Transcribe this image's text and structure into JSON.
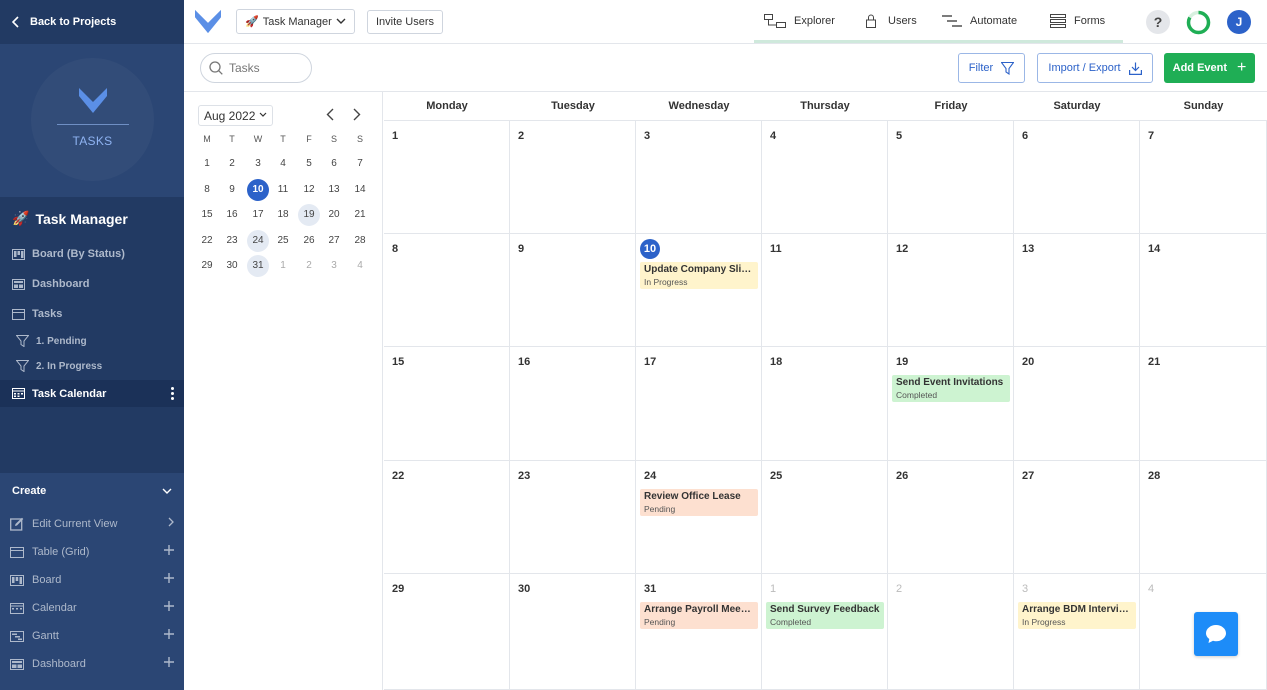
{
  "sidebar": {
    "back_label": "Back to Projects",
    "logo_text": "TASKS",
    "project_title": "Task Manager",
    "nav": {
      "board": "Board (By Status)",
      "dashboard": "Dashboard",
      "tasks": "Tasks",
      "pending": "1. Pending",
      "in_progress": "2. In Progress",
      "calendar": "Task Calendar"
    },
    "create": {
      "heading": "Create",
      "edit_view": "Edit Current View",
      "table": "Table (Grid)",
      "board": "Board",
      "calendar": "Calendar",
      "gantt": "Gantt",
      "dashboard": "Dashboard"
    }
  },
  "topbar": {
    "project_select": "Task Manager",
    "invite": "Invite Users",
    "tabs": {
      "explorer": "Explorer",
      "users": "Users",
      "automate": "Automate",
      "forms": "Forms"
    },
    "help": "?",
    "avatar": "J"
  },
  "toolbar": {
    "search_placeholder": "Tasks",
    "filter": "Filter",
    "import_export": "Import / Export",
    "add_event": "Add Event"
  },
  "minical": {
    "month": "Aug 2022",
    "dow": [
      "M",
      "T",
      "W",
      "T",
      "F",
      "S",
      "S"
    ],
    "weeks": [
      [
        "1",
        "2",
        "3",
        "4",
        "5",
        "6",
        "7"
      ],
      [
        "8",
        "9",
        "10",
        "11",
        "12",
        "13",
        "14"
      ],
      [
        "15",
        "16",
        "17",
        "18",
        "19",
        "20",
        "21"
      ],
      [
        "22",
        "23",
        "24",
        "25",
        "26",
        "27",
        "28"
      ],
      [
        "29",
        "30",
        "31",
        "1",
        "2",
        "3",
        "4"
      ]
    ]
  },
  "calendar": {
    "days_of_week": [
      "Monday",
      "Tuesday",
      "Wednesday",
      "Thursday",
      "Friday",
      "Saturday",
      "Sunday"
    ],
    "weeks": [
      [
        "1",
        "2",
        "3",
        "4",
        "5",
        "6",
        "7"
      ],
      [
        "8",
        "9",
        "10",
        "11",
        "12",
        "13",
        "14"
      ],
      [
        "15",
        "16",
        "17",
        "18",
        "19",
        "20",
        "21"
      ],
      [
        "22",
        "23",
        "24",
        "25",
        "26",
        "27",
        "28"
      ],
      [
        "29",
        "30",
        "31",
        "1",
        "2",
        "3",
        "4"
      ]
    ],
    "events": {
      "aug10": {
        "title": "Update Company Slides",
        "status": "In Progress"
      },
      "aug19": {
        "title": "Send Event Invitations",
        "status": "Completed"
      },
      "aug24": {
        "title": "Review Office Lease",
        "status": "Pending"
      },
      "aug31": {
        "title": "Arrange Payroll Meeting",
        "status": "Pending"
      },
      "sep1": {
        "title": "Send Survey Feedback",
        "status": "Completed"
      },
      "sep3": {
        "title": "Arrange BDM Interviews",
        "status": "In Progress"
      }
    }
  },
  "colors": {
    "sidebar_bg": "#223a63",
    "accent": "#2c62c9",
    "add_button": "#1fae55",
    "status_in_progress": "#fff4cc",
    "status_completed": "#cdf3d1",
    "status_pending": "#fde0d0"
  }
}
